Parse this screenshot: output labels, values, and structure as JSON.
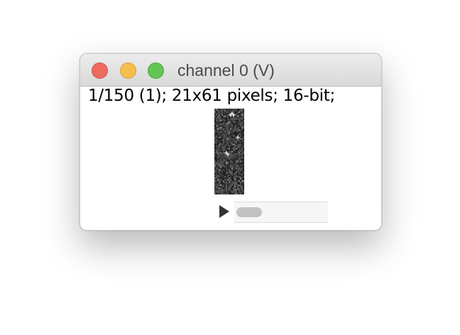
{
  "window": {
    "title": "channel 0 (V)",
    "info": "1/150 (1); 21x61 pixels; 16-bit;"
  },
  "controls": {
    "close_color": "#ed6a5e",
    "minimize_color": "#f5bf4f",
    "maximize_color": "#62c554",
    "play_icon": "play-icon",
    "slice_slider": {
      "current_slice": 1,
      "total_slices": 150
    }
  }
}
